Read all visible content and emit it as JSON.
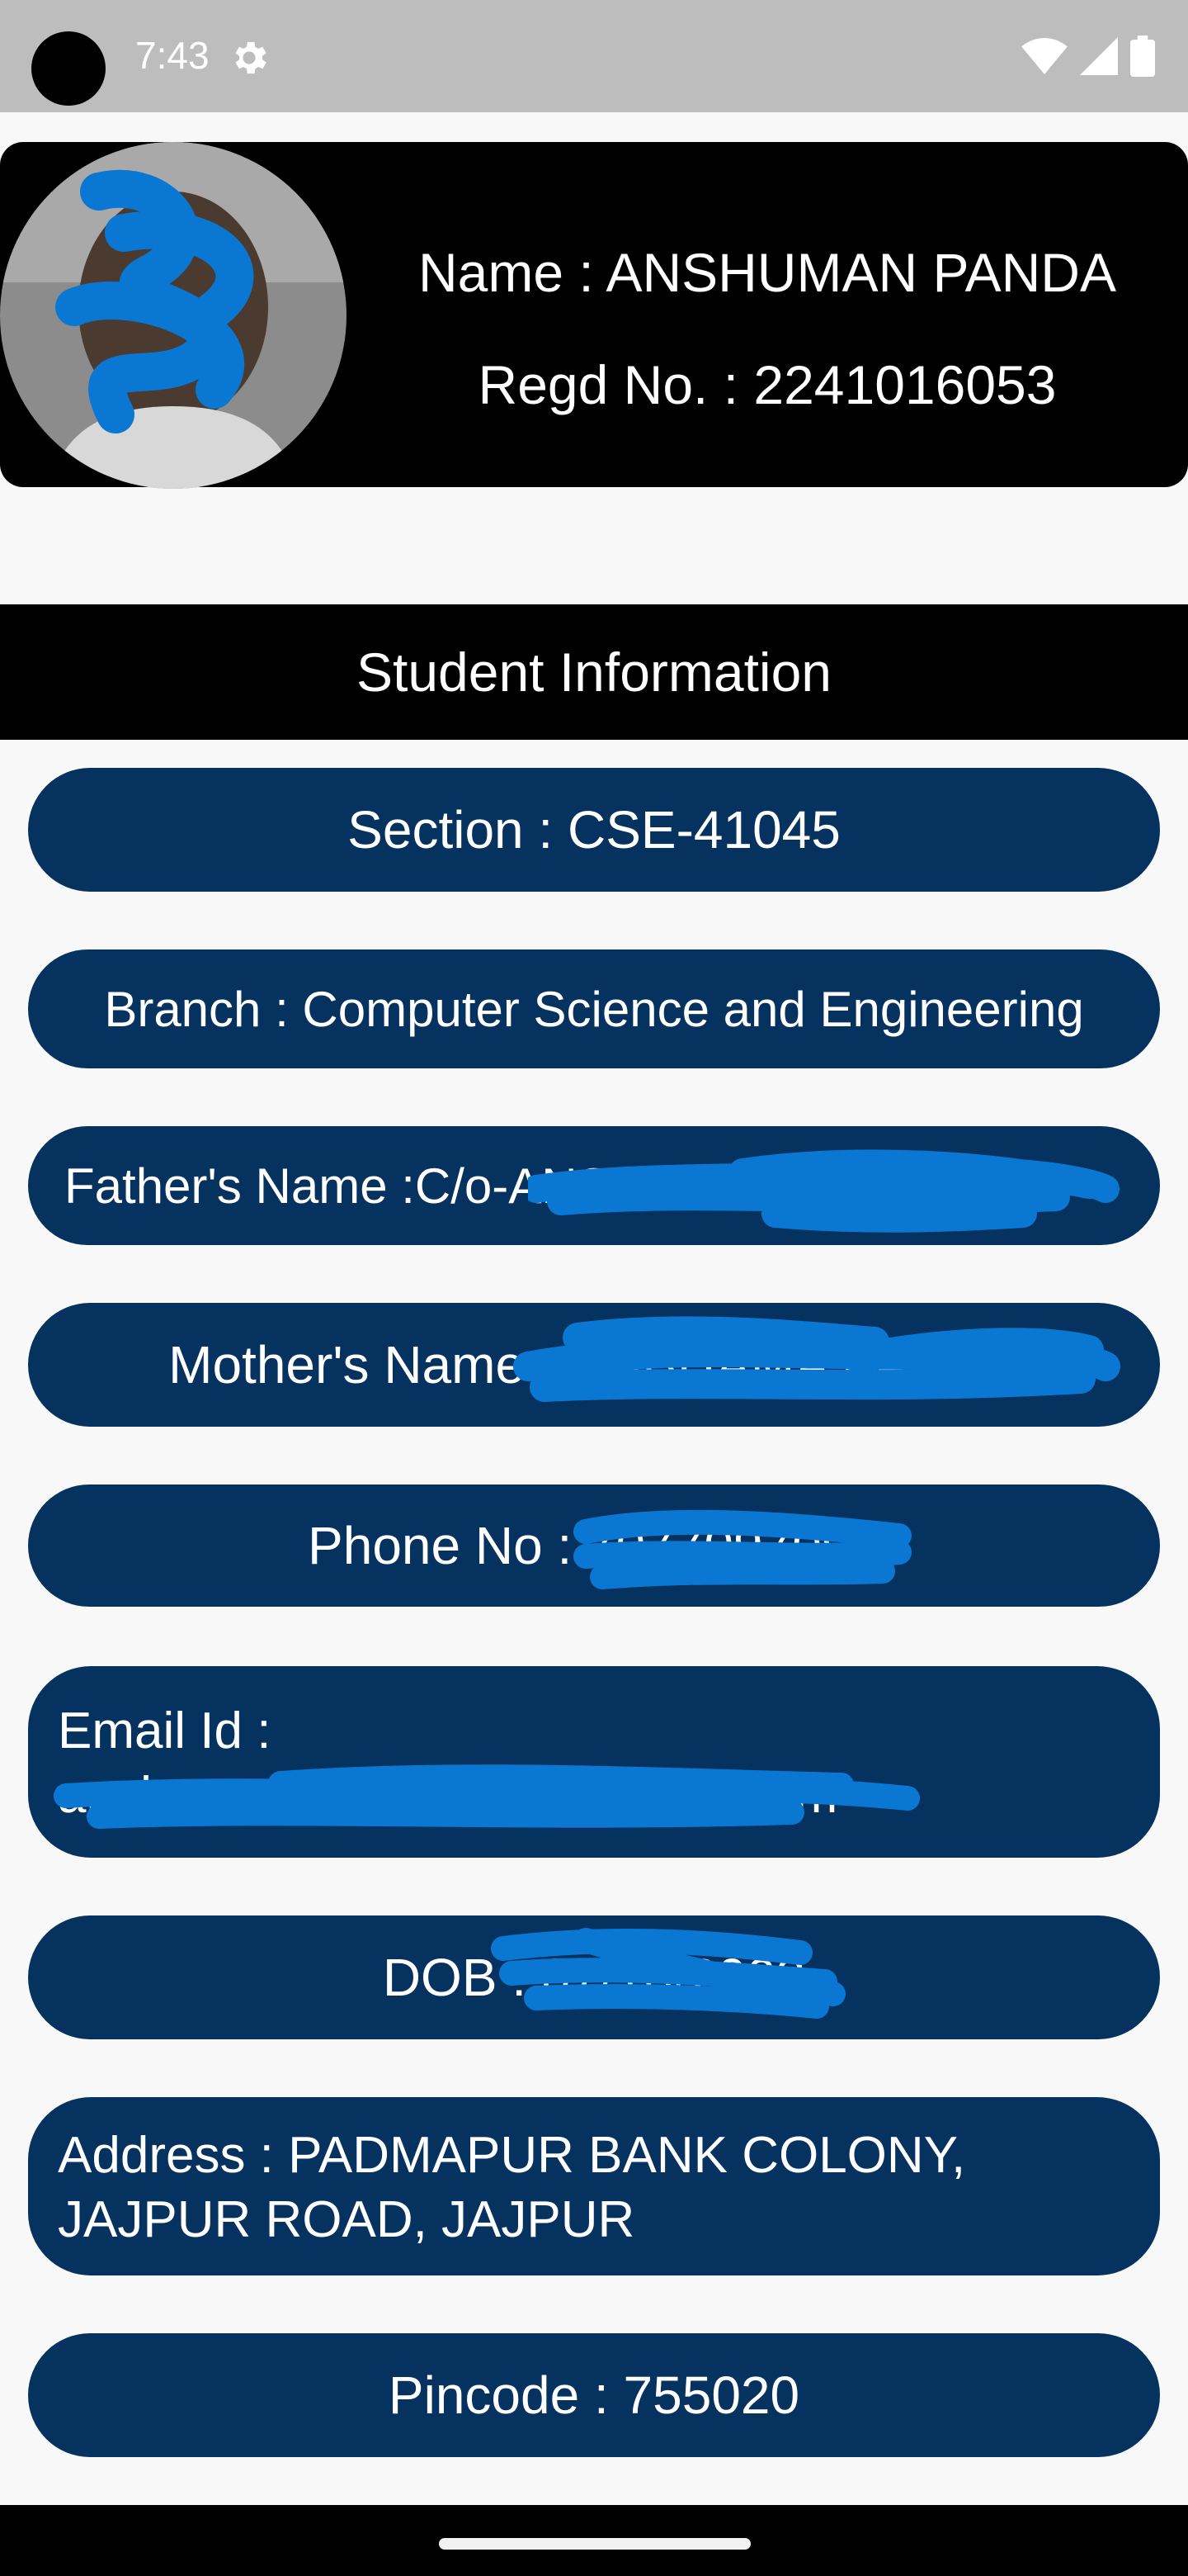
{
  "status_bar": {
    "time": "7:43"
  },
  "profile": {
    "name_text": "Name : ANSHUMAN PANDA",
    "regd_text": "Regd No. : 2241016053"
  },
  "section_title": "Student Information",
  "info": {
    "section": "Section : CSE-41045",
    "branch": "Branch : Computer Science and Engineering",
    "father": "Father's Name :C/o-ANSHUMAN KR PANDA",
    "mother": "Mother's Name : SUBHAMA PANDA",
    "phone": "Phone No : 7077097091",
    "email_label": "Email Id :",
    "email_value": "anshumanpanda7710@gmail.com",
    "dob": "DOB : 07/10/2003",
    "address": "Address : PADMAPUR BANK COLONY, JAJPUR ROAD, JAJPUR",
    "pincode": "Pincode : 755020"
  },
  "colors": {
    "pill_background": "#05325f",
    "redaction_blue": "#0a78d2",
    "header_background": "#000000"
  }
}
